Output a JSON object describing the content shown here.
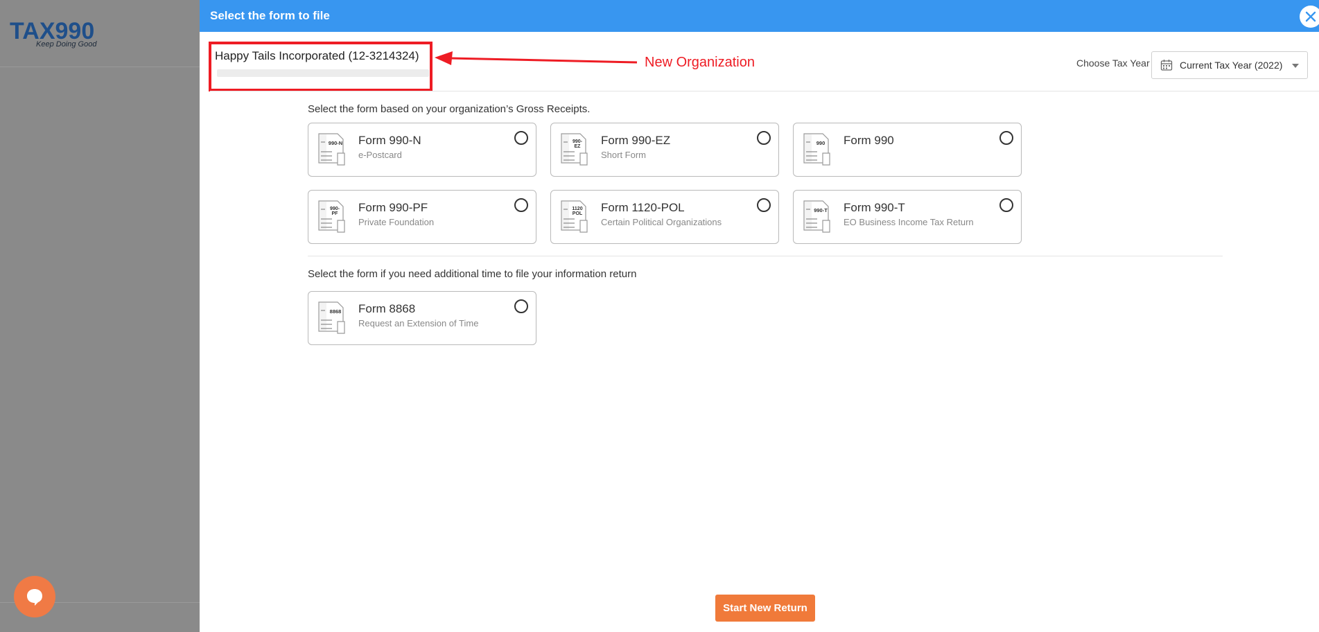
{
  "app": {
    "logo_text_a": "TA",
    "logo_text_x": "X",
    "logo_text_b": "990",
    "tagline": "Keep Doing Good"
  },
  "modal": {
    "title": "Select the form to file"
  },
  "organization": {
    "name": "Happy Tails Incorporated (12-3214324)"
  },
  "annotation": {
    "text": "New Organization",
    "color": "#ee1c24"
  },
  "tax_year": {
    "label": "Choose Tax Year",
    "selected": "Current Tax Year (2022)"
  },
  "sections": {
    "gross_receipts_label": "Select the form based on your organization’s Gross Receipts.",
    "extension_label": "Select the form if you need additional time to file your information return"
  },
  "forms": [
    {
      "icon_code": "990-N",
      "title": "Form 990-N",
      "subtitle": "e-Postcard"
    },
    {
      "icon_code": "990-EZ",
      "title": "Form 990-EZ",
      "subtitle": "Short Form"
    },
    {
      "icon_code": "990",
      "title": "Form 990",
      "subtitle": ""
    },
    {
      "icon_code": "990-PF",
      "title": "Form 990-PF",
      "subtitle": "Private Foundation"
    },
    {
      "icon_code": "1120 POL",
      "title": "Form 1120-POL",
      "subtitle": "Certain Political Organizations"
    },
    {
      "icon_code": "990-T",
      "title": "Form 990-T",
      "subtitle": "EO Business Income Tax Return"
    }
  ],
  "extension_forms": [
    {
      "icon_code": "8868",
      "title": "Form 8868",
      "subtitle": "Request an Extension of Time"
    }
  ],
  "actions": {
    "start_label": "Start New Return"
  },
  "colors": {
    "header": "#3896f0",
    "accent_button": "#f07a3a",
    "chat": "#f07a45"
  }
}
